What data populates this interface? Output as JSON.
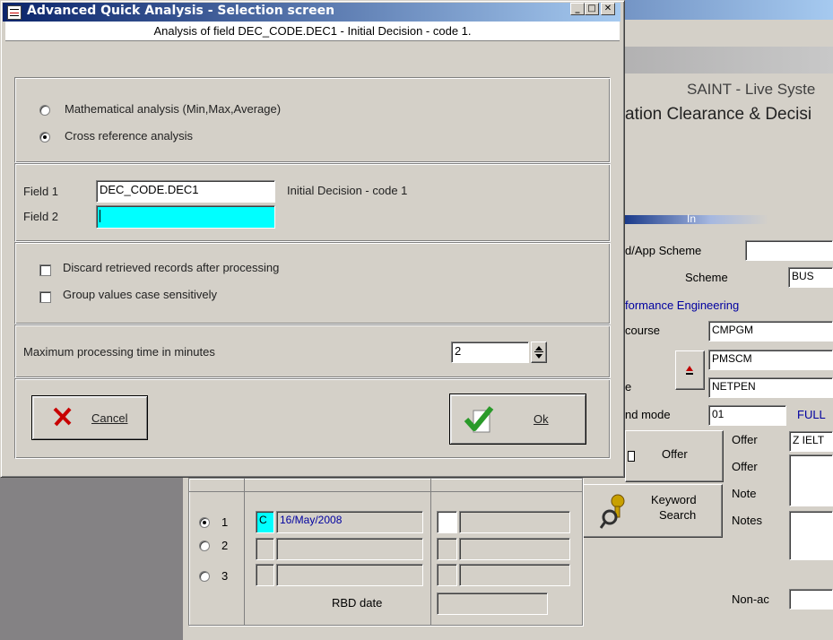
{
  "dialog": {
    "title": "Advanced Quick Analysis - Selection screen",
    "subtitle": "Analysis of field DEC_CODE.DEC1 - Initial Decision - code 1.",
    "title_controls": [
      "_",
      "□",
      "✕"
    ],
    "analysis_options": [
      {
        "label": "Mathematical analysis (Min,Max,Average)",
        "selected": false
      },
      {
        "label": "Cross reference analysis",
        "selected": true
      }
    ],
    "field1_label": "Field 1",
    "field1_value": "DEC_CODE.DEC1",
    "field1_description": "Initial Decision - code 1",
    "field2_label": "Field 2",
    "field2_value": "",
    "checkboxes": [
      {
        "label": "Discard retrieved records after processing",
        "checked": false
      },
      {
        "label": "Group values case sensitively",
        "checked": false
      }
    ],
    "max_time_label": "Maximum processing time in minutes",
    "max_time_value": "2",
    "cancel_label": "Cancel",
    "ok_label": "Ok"
  },
  "background": {
    "system_title": "SAINT - Live Syste",
    "subtitle": "ation Clearance & Decisi",
    "section_heading": "In",
    "app_scheme_label": "d/App Scheme",
    "scheme_label": "Scheme",
    "scheme_value": "BUS",
    "dept_text": "formance Engineering",
    "course_label": "course",
    "course_values": [
      "CMPGM",
      "PMSCM",
      "NETPEN"
    ],
    "e_label": "e",
    "mode_label": "nd mode",
    "mode_value": "01",
    "mode_desc": "FULL",
    "offer_button": "Offer",
    "offer_label1": "Offer",
    "offer_value1": "Z IELT",
    "offer_label2": "Offer",
    "keyword_button": [
      "Keyword",
      "Search"
    ],
    "note_label": "Note",
    "notes_label": "Notes",
    "nonac_label": "Non-ac",
    "rows": [
      {
        "label": "1",
        "selected": true,
        "code": "C",
        "date": "16/May/2008"
      },
      {
        "label": "2",
        "selected": false,
        "code": "",
        "date": ""
      },
      {
        "label": "3",
        "selected": false,
        "code": "",
        "date": ""
      }
    ],
    "rbd_label": "RBD date"
  },
  "colors": {
    "title_bar": "#0a246a",
    "face": "#d4d0c8",
    "field_highlight": "#00ffff",
    "link_blue": "#0000a0"
  }
}
